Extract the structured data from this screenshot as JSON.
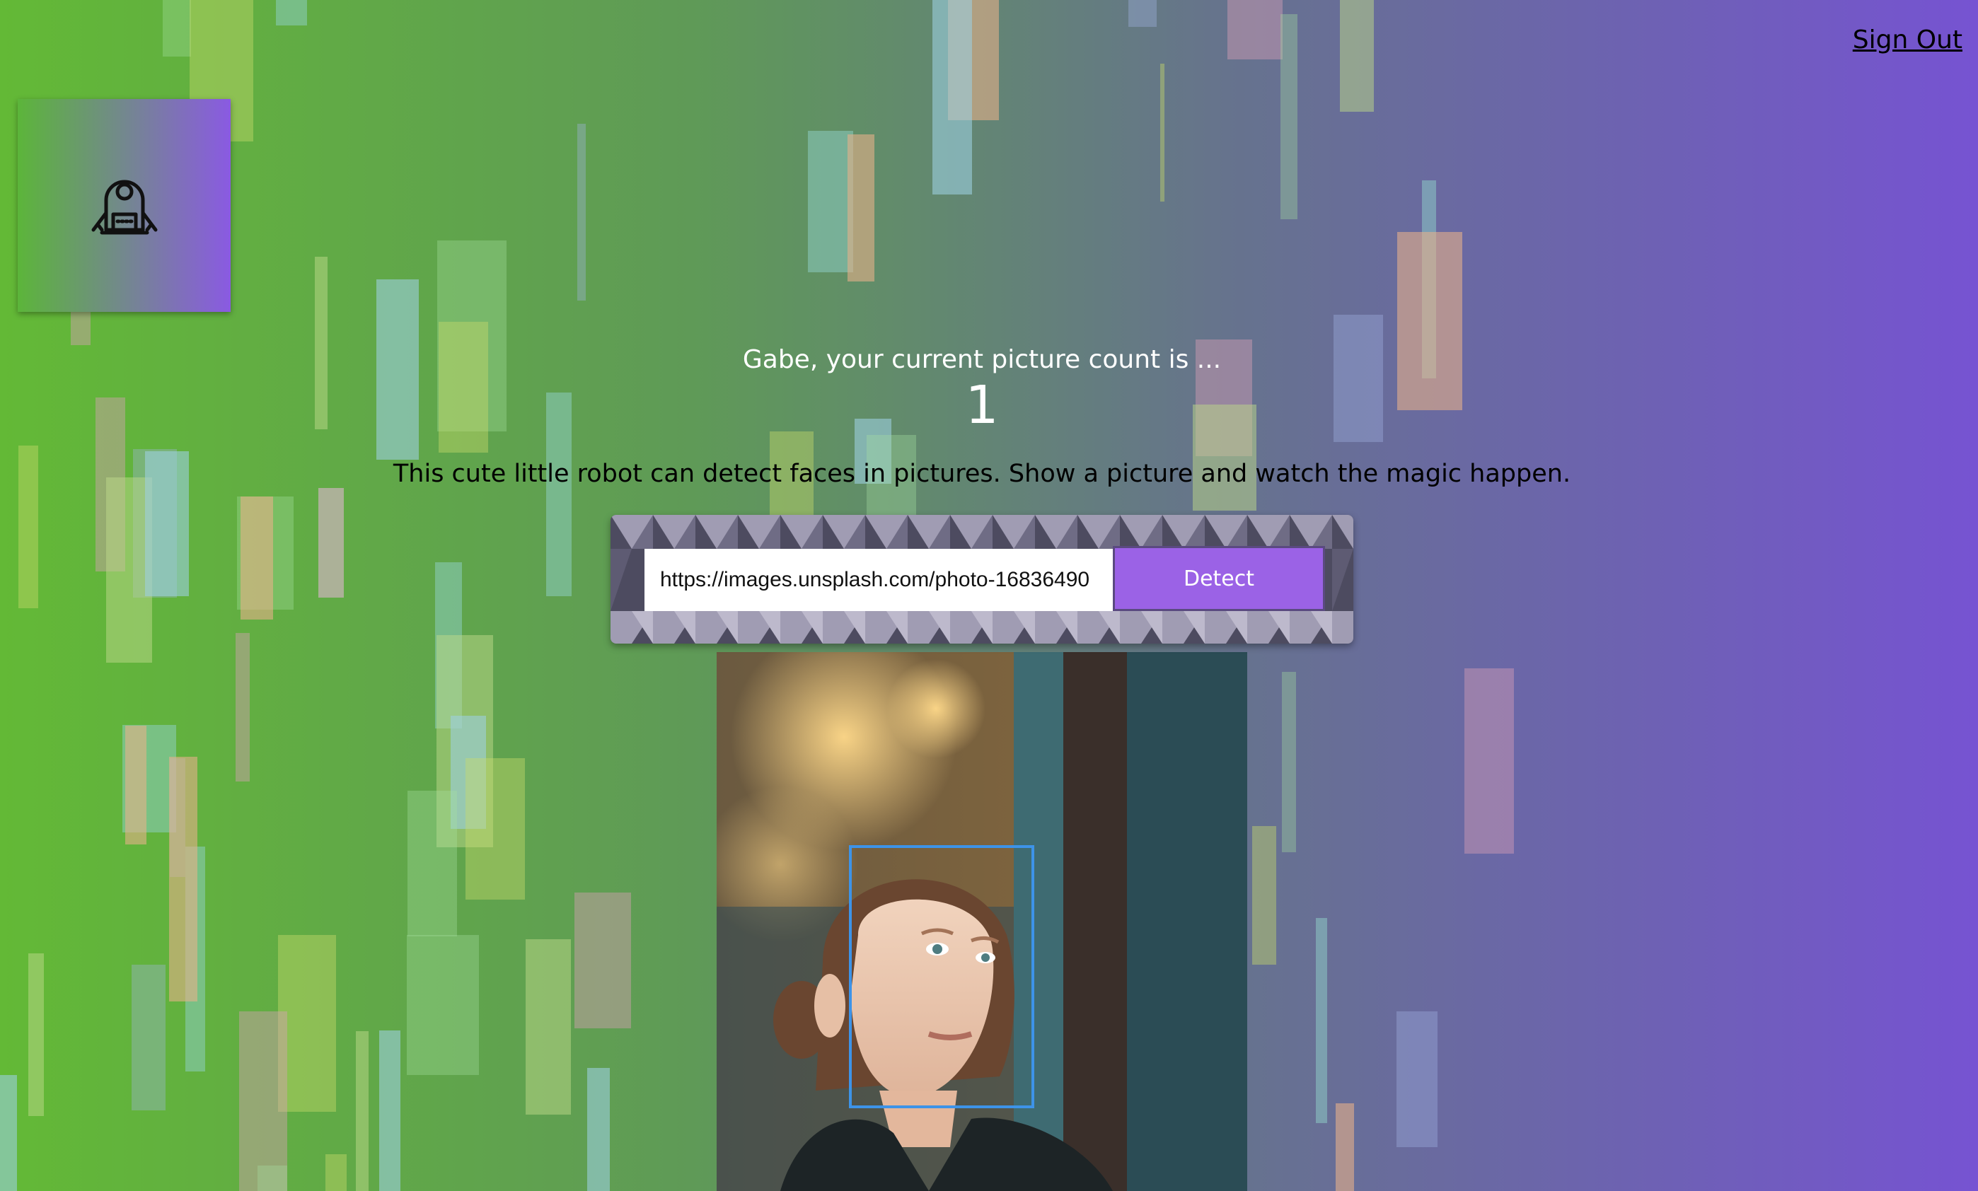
{
  "header": {
    "sign_out_label": "Sign Out"
  },
  "logo": {
    "icon": "robot-icon"
  },
  "greeting": {
    "text": "Gabe, your current picture count is ...",
    "count": "1"
  },
  "tagline": "This cute little robot can detect faces in pictures. Show a picture and watch the magic happen.",
  "form": {
    "url_value": "https://images.unsplash.com/photo-16836490",
    "detect_label": "Detect"
  },
  "colors": {
    "accent": "#9b62e6",
    "face_box": "#3d93e8",
    "gradient_start": "#63b936",
    "gradient_end": "#7653d2"
  }
}
